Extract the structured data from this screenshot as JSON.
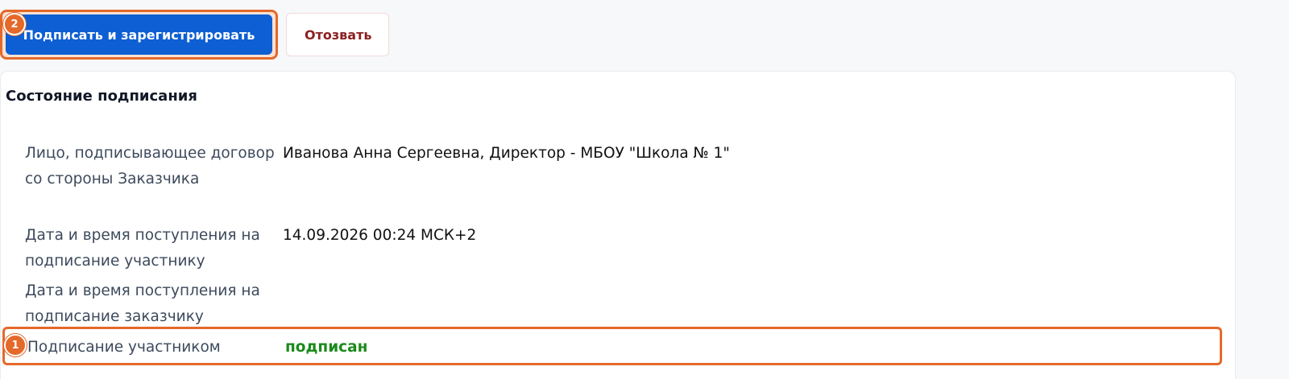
{
  "toolbar": {
    "sign_register_label": "Подписать и зарегистрировать",
    "revoke_label": "Отозвать"
  },
  "markers": {
    "first": "1",
    "second": "2"
  },
  "signing_state": {
    "title": "Состояние подписания",
    "rows": [
      {
        "label": "Лицо, подписывающее договор со стороны Заказчика",
        "value": "Иванова Анна Сергеевна, Директор - МБОУ \"Школа № 1\""
      },
      {
        "label": "Дата и время поступления на подписание участнику",
        "value": "14.09.2026 00:24 МСК+2"
      },
      {
        "label": "Дата и время поступления на подписание заказчику",
        "value": ""
      },
      {
        "label": "Подписание участником",
        "value": "подписан"
      }
    ]
  },
  "colors": {
    "primary": "#0d5fd3",
    "danger_text": "#8a2121",
    "highlight": "#e4692a",
    "success": "#1b8a1b"
  }
}
